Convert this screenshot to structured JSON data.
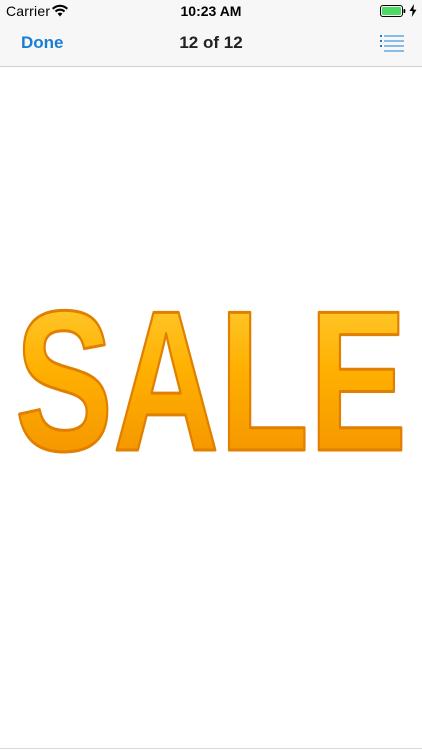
{
  "status_bar": {
    "carrier": "Carrier",
    "time": "10:23 AM",
    "battery_color": "#4cd964"
  },
  "nav": {
    "done_label": "Done",
    "title": "12 of 12",
    "accent_color": "#1a7fd4"
  },
  "content": {
    "image_text": "SALE",
    "image_colors": {
      "fill_light": "#ffd23f",
      "fill_mid": "#ffb000",
      "fill_dark": "#f08c00"
    }
  },
  "icons": {
    "wifi": "wifi-icon",
    "battery": "battery-icon",
    "charging": "charging-bolt-icon",
    "list": "list-icon"
  }
}
